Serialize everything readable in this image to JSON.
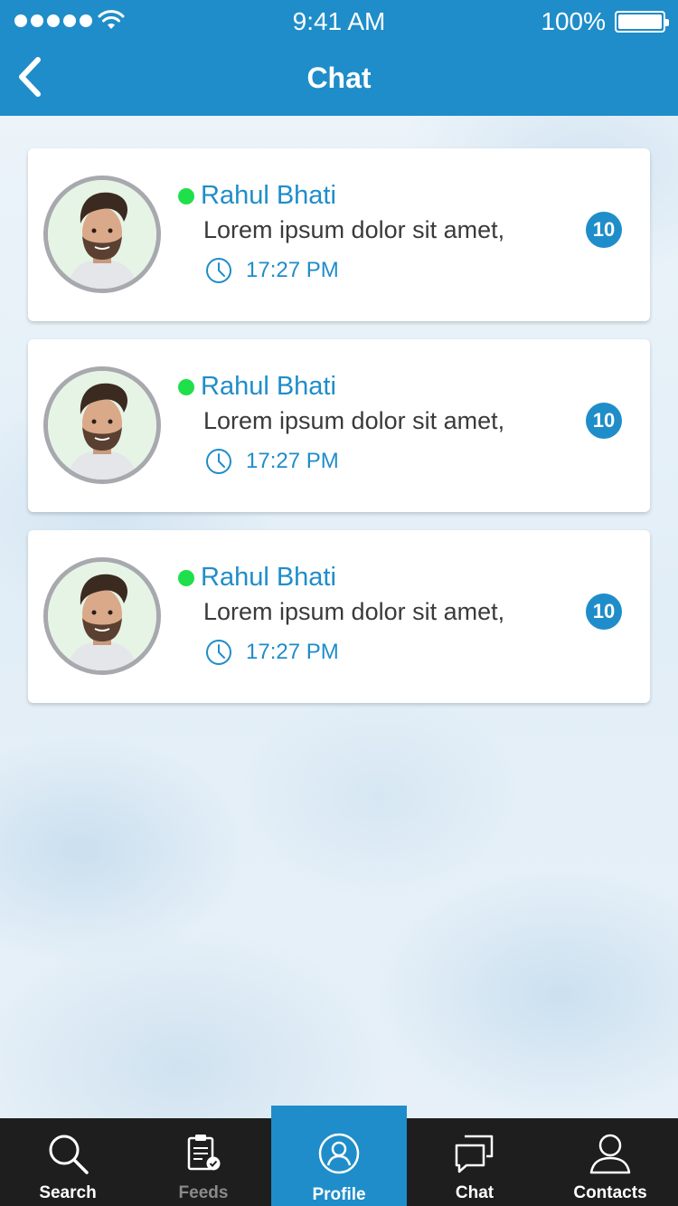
{
  "status_bar": {
    "time": "9:41 AM",
    "battery": "100%"
  },
  "header": {
    "title": "Chat"
  },
  "chats": [
    {
      "name": "Rahul Bhati",
      "message": "Lorem ipsum dolor sit amet,",
      "time": "17:27 PM",
      "unread": "10",
      "online": true
    },
    {
      "name": "Rahul Bhati",
      "message": "Lorem ipsum dolor sit amet,",
      "time": "17:27 PM",
      "unread": "10",
      "online": true
    },
    {
      "name": "Rahul Bhati",
      "message": "Lorem ipsum dolor sit amet,",
      "time": "17:27 PM",
      "unread": "10",
      "online": true
    }
  ],
  "tabs": [
    {
      "label": "Search",
      "icon": "search-icon"
    },
    {
      "label": "Feeds",
      "icon": "clipboard-check-icon"
    },
    {
      "label": "Profile",
      "icon": "user-circle-icon",
      "active": true
    },
    {
      "label": "Chat",
      "icon": "chat-bubbles-icon"
    },
    {
      "label": "Contacts",
      "icon": "user-icon"
    }
  ],
  "colors": {
    "primary": "#1f8dc9",
    "online": "#1fe04a",
    "tabbar": "#1e1e1e"
  }
}
